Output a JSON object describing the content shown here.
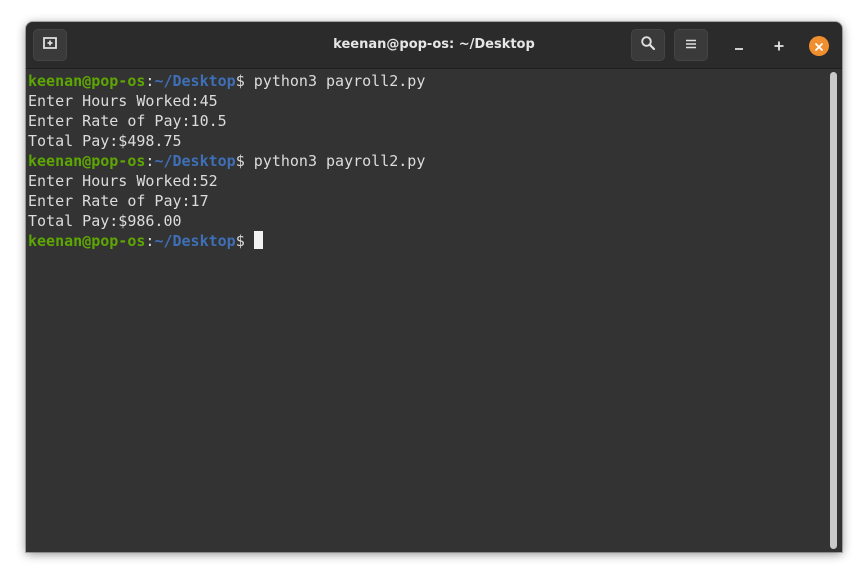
{
  "window": {
    "title": "keenan@pop-os: ~/Desktop"
  },
  "titlebar": {
    "new_tab_icon": "new-tab-icon",
    "search_icon": "search-icon",
    "menu_icon": "hamburger-menu-icon",
    "minimize_icon": "minimize-icon",
    "maximize_icon": "maximize-icon",
    "close_icon": "close-icon",
    "close_color": "#f08f2e"
  },
  "prompt": {
    "user_host": "keenan@pop-os",
    "colon": ":",
    "path": "~/Desktop",
    "dollar": "$ ",
    "user_color": "#5ea702",
    "path_color": "#3f6fb6"
  },
  "terminal": {
    "lines": [
      {
        "type": "prompt",
        "command": "python3 payroll2.py"
      },
      {
        "type": "output",
        "text": "Enter Hours Worked:45"
      },
      {
        "type": "output",
        "text": "Enter Rate of Pay:10.5"
      },
      {
        "type": "output",
        "text": "Total Pay:$498.75"
      },
      {
        "type": "prompt",
        "command": "python3 payroll2.py"
      },
      {
        "type": "output",
        "text": "Enter Hours Worked:52"
      },
      {
        "type": "output",
        "text": "Enter Rate of Pay:17"
      },
      {
        "type": "output",
        "text": "Total Pay:$986.00"
      },
      {
        "type": "prompt",
        "command": ""
      }
    ]
  }
}
